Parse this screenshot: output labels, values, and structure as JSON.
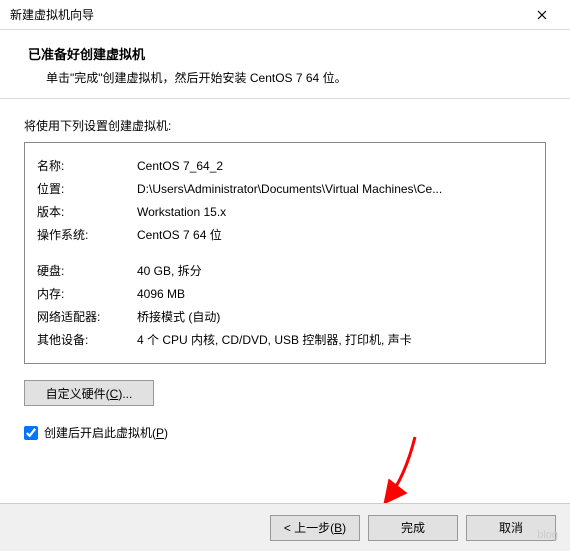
{
  "window": {
    "title": "新建虚拟机向导"
  },
  "header": {
    "heading": "已准备好创建虚拟机",
    "subtitle": "单击\"完成\"创建虚拟机，然后开始安装 CentOS 7 64 位。"
  },
  "intro": "将使用下列设置创建虚拟机:",
  "settings": {
    "name_label": "名称:",
    "name_value": "CentOS 7_64_2",
    "location_label": "位置:",
    "location_value": "D:\\Users\\Administrator\\Documents\\Virtual Machines\\Ce...",
    "version_label": "版本:",
    "version_value": "Workstation 15.x",
    "os_label": "操作系统:",
    "os_value": "CentOS 7 64 位",
    "disk_label": "硬盘:",
    "disk_value": "40 GB, 拆分",
    "memory_label": "内存:",
    "memory_value": "4096 MB",
    "network_label": "网络适配器:",
    "network_value": "桥接模式 (自动)",
    "other_label": "其他设备:",
    "other_value": "4 个 CPU 内核, CD/DVD, USB 控制器, 打印机, 声卡"
  },
  "buttons": {
    "customize_pre": "自定义硬件(",
    "customize_key": "C",
    "customize_post": ")...",
    "poweron_pre": "创建后开启此虚拟机(",
    "poweron_key": "P",
    "poweron_post": ")",
    "back_pre": "< 上一步(",
    "back_key": "B",
    "back_post": ")",
    "finish": "完成",
    "cancel": "取消"
  },
  "watermark": "blog"
}
